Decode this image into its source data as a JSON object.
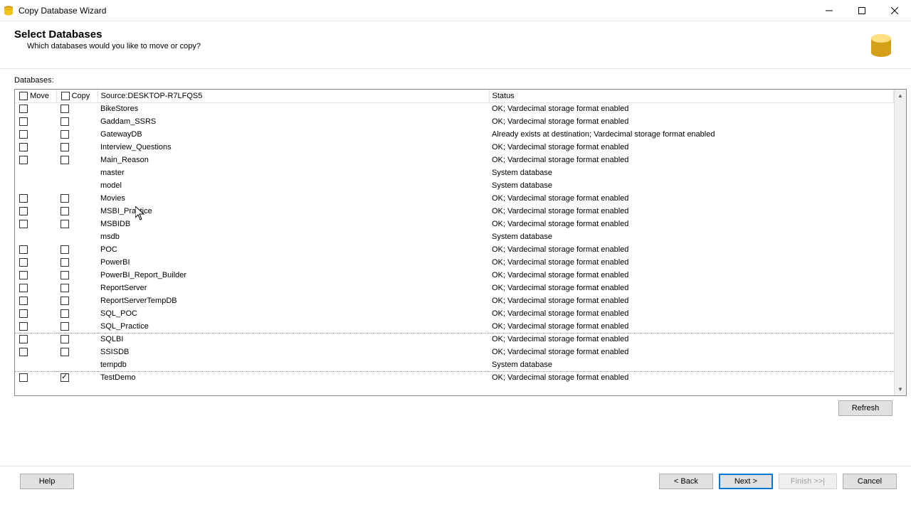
{
  "window": {
    "title": "Copy Database Wizard"
  },
  "header": {
    "title": "Select Databases",
    "subtitle": "Which databases would you like to move or copy?"
  },
  "label_databases": "Databases:",
  "columns": {
    "move": "Move",
    "copy": "Copy",
    "source": "Source:DESKTOP-R7LFQS5",
    "status": "Status"
  },
  "status_ok": "OK; Vardecimal storage format enabled",
  "status_exists": "Already exists at destination; Vardecimal storage format enabled",
  "status_system": "System database",
  "rows": [
    {
      "name": "BikeStores",
      "status_key": "ok",
      "checkable": true,
      "move": false,
      "copy": false
    },
    {
      "name": "Gaddam_SSRS",
      "status_key": "ok",
      "checkable": true,
      "move": false,
      "copy": false
    },
    {
      "name": "GatewayDB",
      "status_key": "exists",
      "checkable": true,
      "move": false,
      "copy": false
    },
    {
      "name": "Interview_Questions",
      "status_key": "ok",
      "checkable": true,
      "move": false,
      "copy": false
    },
    {
      "name": "Main_Reason",
      "status_key": "ok",
      "checkable": true,
      "move": false,
      "copy": false
    },
    {
      "name": "master",
      "status_key": "system",
      "checkable": false
    },
    {
      "name": "model",
      "status_key": "system",
      "checkable": false
    },
    {
      "name": "Movies",
      "status_key": "ok",
      "checkable": true,
      "move": false,
      "copy": false
    },
    {
      "name": "MSBI_Practice",
      "status_key": "ok",
      "checkable": true,
      "move": false,
      "copy": false
    },
    {
      "name": "MSBIDB",
      "status_key": "ok",
      "checkable": true,
      "move": false,
      "copy": false
    },
    {
      "name": "msdb",
      "status_key": "system",
      "checkable": false
    },
    {
      "name": "POC",
      "status_key": "ok",
      "checkable": true,
      "move": false,
      "copy": false
    },
    {
      "name": "PowerBI",
      "status_key": "ok",
      "checkable": true,
      "move": false,
      "copy": false
    },
    {
      "name": "PowerBI_Report_Builder",
      "status_key": "ok",
      "checkable": true,
      "move": false,
      "copy": false
    },
    {
      "name": "ReportServer",
      "status_key": "ok",
      "checkable": true,
      "move": false,
      "copy": false
    },
    {
      "name": "ReportServerTempDB",
      "status_key": "ok",
      "checkable": true,
      "move": false,
      "copy": false
    },
    {
      "name": "SQL_POC",
      "status_key": "ok",
      "checkable": true,
      "move": false,
      "copy": false
    },
    {
      "name": "SQL_Practice",
      "status_key": "ok",
      "checkable": true,
      "move": false,
      "copy": false,
      "dotted": true
    },
    {
      "name": "SQLBI",
      "status_key": "ok",
      "checkable": true,
      "move": false,
      "copy": false
    },
    {
      "name": "SSISDB",
      "status_key": "ok",
      "checkable": true,
      "move": false,
      "copy": false
    },
    {
      "name": "tempdb",
      "status_key": "system",
      "checkable": false,
      "dotted": true
    },
    {
      "name": "TestDemo",
      "status_key": "ok",
      "checkable": true,
      "move": false,
      "copy": true
    }
  ],
  "buttons": {
    "refresh": "Refresh",
    "help": "Help",
    "back": "< Back",
    "next": "Next >",
    "finish": "Finish >>|",
    "cancel": "Cancel"
  }
}
